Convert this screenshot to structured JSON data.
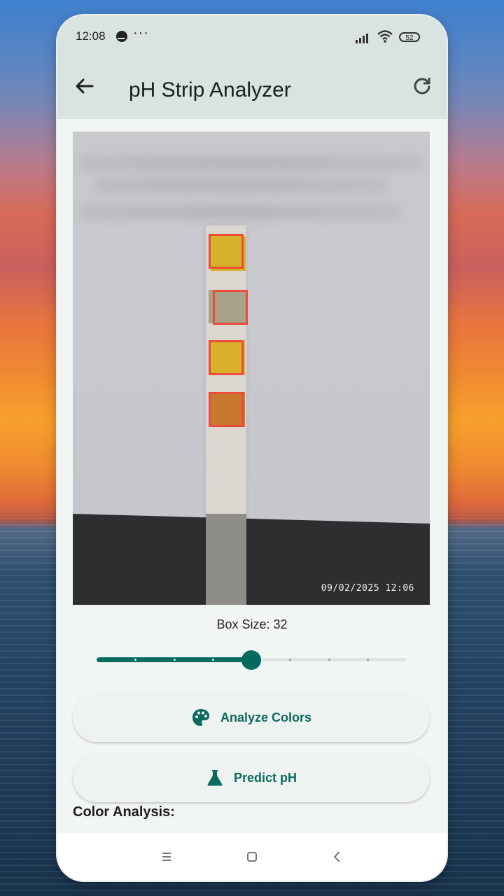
{
  "status_bar": {
    "time": "12:08",
    "more": "···",
    "battery": "52"
  },
  "app_bar": {
    "title": "pH Strip Analyzer",
    "back_icon": "arrow-left-icon",
    "refresh_icon": "refresh-icon"
  },
  "image_preview": {
    "timestamp": "09/02/2025  12:06",
    "pads": [
      {
        "color": "#d7b12a"
      },
      {
        "color": "#a7a28a"
      },
      {
        "color": "#d8b02a"
      },
      {
        "color": "#c8792e"
      }
    ]
  },
  "box_size": {
    "label": "Box Size: 32",
    "value": 32,
    "slider_fraction": 0.5
  },
  "buttons": {
    "analyze": {
      "label": "Analyze Colors",
      "icon": "palette-icon"
    },
    "predict": {
      "label": "Predict pH",
      "icon": "flask-icon"
    }
  },
  "results": {
    "heading": "Color Analysis:"
  },
  "nav_bar": {
    "icons": [
      "menu-icon",
      "home-icon",
      "back-icon"
    ]
  },
  "colors": {
    "accent": "#006b5e",
    "app_bar": "#d9e3df",
    "box_outline": "#ee4b3a"
  }
}
